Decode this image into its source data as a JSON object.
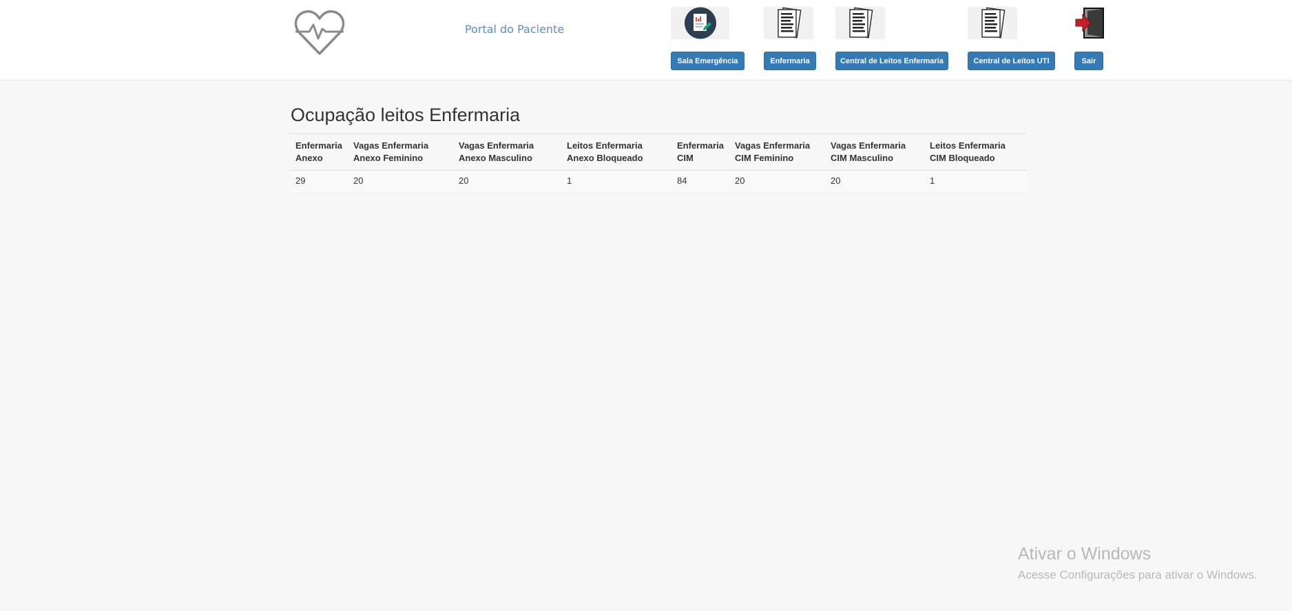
{
  "header": {
    "portal_title": "Portal do Paciente",
    "nav": [
      {
        "label": "Sala Emergência",
        "icon": "emergency-report-icon"
      },
      {
        "label": "Enfermaria",
        "icon": "documents-icon"
      },
      {
        "label": "Central de Leitos Enfermaria",
        "icon": "documents-icon"
      },
      {
        "label": "Central de Leitos UTI",
        "icon": "documents-icon"
      },
      {
        "label": "Sair",
        "icon": "exit-door-icon"
      }
    ],
    "logo_icon": "heart-pulse-icon"
  },
  "main": {
    "heading": "Ocupação leitos Enfermaria",
    "table": {
      "headers": [
        [
          "Enfermaria",
          "Anexo"
        ],
        [
          "Vagas Enfermaria",
          "Anexo Feminino"
        ],
        [
          "Vagas Enfermaria",
          "Anexo Masculino"
        ],
        [
          "Leitos Enfermaria",
          "Anexo Bloqueado"
        ],
        [
          "Enfermaria",
          "CIM"
        ],
        [
          "Vagas Enfermaria",
          "CIM Feminino"
        ],
        [
          "Vagas Enfermaria",
          "CIM Masculino"
        ],
        [
          "Leitos Enfermaria",
          "CIM Bloqueado"
        ]
      ],
      "rows": [
        [
          "29",
          "20",
          "20",
          "1",
          "84",
          "20",
          "20",
          "1"
        ]
      ]
    }
  },
  "watermark": {
    "title": "Ativar o Windows",
    "subtitle": "Acesse Configurações para ativar o Windows."
  },
  "colors": {
    "button_bg": "#337ab7",
    "portal_title": "#5b8fc4",
    "exit_arrow": "#c0202a"
  }
}
